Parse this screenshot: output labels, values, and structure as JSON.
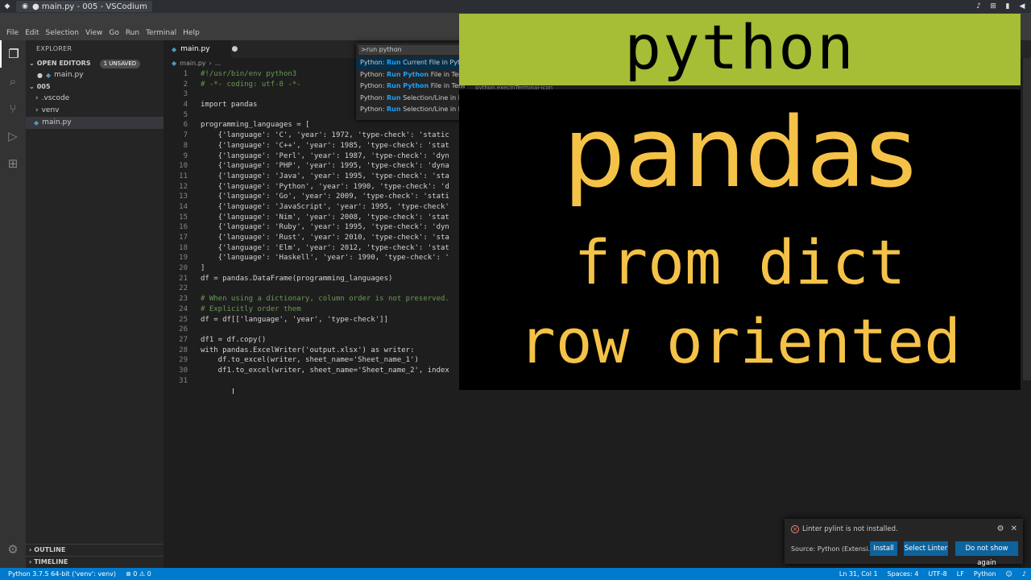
{
  "os": {
    "task_title": "● main.py - 005 - VSCodium",
    "tray_icons": [
      "bell-icon",
      "network-icon",
      "battery-icon",
      "volume-icon"
    ]
  },
  "menu": [
    "File",
    "Edit",
    "Selection",
    "View",
    "Go",
    "Run",
    "Terminal",
    "Help"
  ],
  "sidebar": {
    "title": "EXPLORER",
    "open_editors": "OPEN EDITORS",
    "unsaved_badge": "1 UNSAVED",
    "open_file": "main.py",
    "folder": "005",
    "items": [
      ".vscode",
      "venv",
      "main.py"
    ],
    "outline": "OUTLINE",
    "timeline": "TIMELINE"
  },
  "editor": {
    "tab_label": "main.py",
    "breadcrumb_file": "main.py",
    "breadcrumb_more": "...",
    "lines": [
      "#!/usr/bin/env python3",
      "# -*- coding: utf-8 -*-",
      "",
      "import pandas",
      "",
      "programming_languages = [",
      "    {'language': 'C', 'year': 1972, 'type-check': 'static",
      "    {'language': 'C++', 'year': 1985, 'type-check': 'stat",
      "    {'language': 'Perl', 'year': 1987, 'type-check': 'dyn",
      "    {'language': 'PHP', 'year': 1995, 'type-check': 'dyna",
      "    {'language': 'Java', 'year': 1995, 'type-check': 'sta",
      "    {'language': 'Python', 'year': 1990, 'type-check': 'd",
      "    {'language': 'Go', 'year': 2009, 'type-check': 'stati",
      "    {'language': 'JavaScript', 'year': 1995, 'type-check'",
      "    {'language': 'Nim', 'year': 2008, 'type-check': 'stat",
      "    {'language': 'Ruby', 'year': 1995, 'type-check': 'dyn",
      "    {'language': 'Rust', 'year': 2010, 'type-check': 'sta",
      "    {'language': 'Elm', 'year': 2012, 'type-check': 'stat",
      "    {'language': 'Haskell', 'year': 1990, 'type-check': '",
      "]",
      "df = pandas.DataFrame(programming_languages)",
      "",
      "# When using a dictionary, column order is not preserved.",
      "# Explicitly order them",
      "df = df[['language', 'year', 'type-check']]",
      "",
      "df1 = df.copy()",
      "with pandas.ExcelWriter('output.xlsx') as writer:",
      "    df.to_excel(writer, sheet_name='Sheet_name_1')",
      "    df1.to_excel(writer, sheet_name='Sheet_name_2', index",
      ""
    ]
  },
  "palette": {
    "query": ">run python",
    "items": [
      {
        "pre": "Python: ",
        "hl": "Run",
        "post": " Current File in Pyt"
      },
      {
        "pre": "Python: ",
        "hl": "Run Python",
        "post": " File in Term"
      },
      {
        "pre": "Python: ",
        "hl": "Run Python",
        "post": " File in Terminal"
      },
      {
        "pre": "Python: ",
        "hl": "Run",
        "post": " Selection/Line in P"
      },
      {
        "pre": "Python: ",
        "hl": "Run",
        "post": " Selection/Line in P"
      }
    ],
    "under_hint": "python.execInTerminal-icon"
  },
  "overlay": {
    "top": "python",
    "title": "pandas",
    "line1": "from dict",
    "line2": "row oriented"
  },
  "notification": {
    "message": "Linter pylint is not installed.",
    "source": "Source: Python (Extensi...",
    "install": "Install",
    "select_linter": "Select Linter",
    "dont_show": "Do not show again"
  },
  "status": {
    "interpreter": "Python 3.7.5 64-bit ('venv': venv)",
    "problems": "⊗ 0 ⚠ 0",
    "position": "Ln 31, Col 1",
    "spaces": "Spaces: 4",
    "encoding": "UTF-8",
    "eol": "LF",
    "language": "Python"
  },
  "colors": {
    "overlay_green": "#a5be36",
    "overlay_text": "#f5c248",
    "status_blue": "#007acc"
  }
}
